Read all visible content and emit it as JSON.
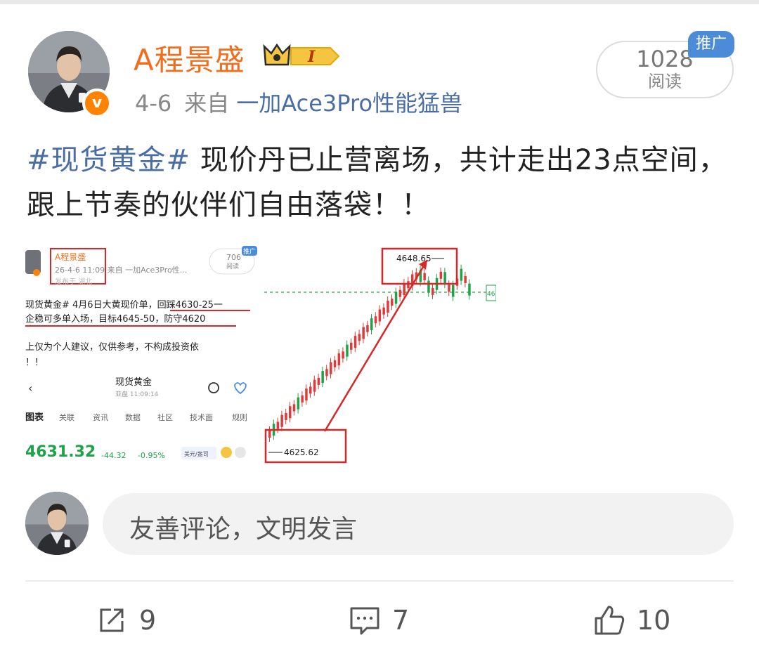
{
  "post": {
    "author": "A程景盛",
    "date": "4-6",
    "source_prefix": "来自",
    "device": "一加Ace3Pro性能猛兽",
    "read_count": "1028",
    "read_label": "阅读",
    "promo_badge": "推广",
    "hashtag": "#现货黄金#",
    "text": " 现价丹已止营离场，共计走出23点空间，跟上节奏的伙伴们自由落袋！！"
  },
  "embedded_screenshot": {
    "author": "A程景盛",
    "meta": "26-4-6 11:09  来自 一加Ace3Pro性...",
    "location": "发布于 湖北",
    "reads": "706",
    "reads_label": "阅读",
    "promo_badge": "推广",
    "line1": "现货黄金# 4月6日大黄现价单，回踩4630-25一",
    "line2": "企稳可多单入场，目标4645-50，防守4620",
    "line3": "上仅为个人建议，仅供参考，不构成投资依",
    "line4": "！！",
    "app_title": "现货黄金",
    "app_subtitle": "亚盘  11:09:14",
    "tabs": [
      "图表",
      "关联",
      "资讯",
      "数据",
      "社区",
      "技术面",
      "规则"
    ],
    "price": "4631.32",
    "change": "-44.32",
    "change_pct": "-0.95%",
    "currency": "美元/盎司"
  },
  "chart": {
    "high_label": "4648.65",
    "low_label": "4625.62",
    "edge_label": "46"
  },
  "chart_data": {
    "type": "candlestick",
    "annotations": [
      "4648.65",
      "4625.62"
    ],
    "high": 4648.65,
    "low": 4625.62
  },
  "comment": {
    "placeholder": "友善评论，文明发言"
  },
  "actions": {
    "share_count": "9",
    "comment_count": "7",
    "like_count": "10"
  },
  "colors": {
    "username": "#f06e1e",
    "link": "#4a6ea3",
    "badge": "#4c8bd8",
    "verified": "#ff8200",
    "candle_up": "#e03b3b",
    "candle_down": "#1fa34a"
  }
}
